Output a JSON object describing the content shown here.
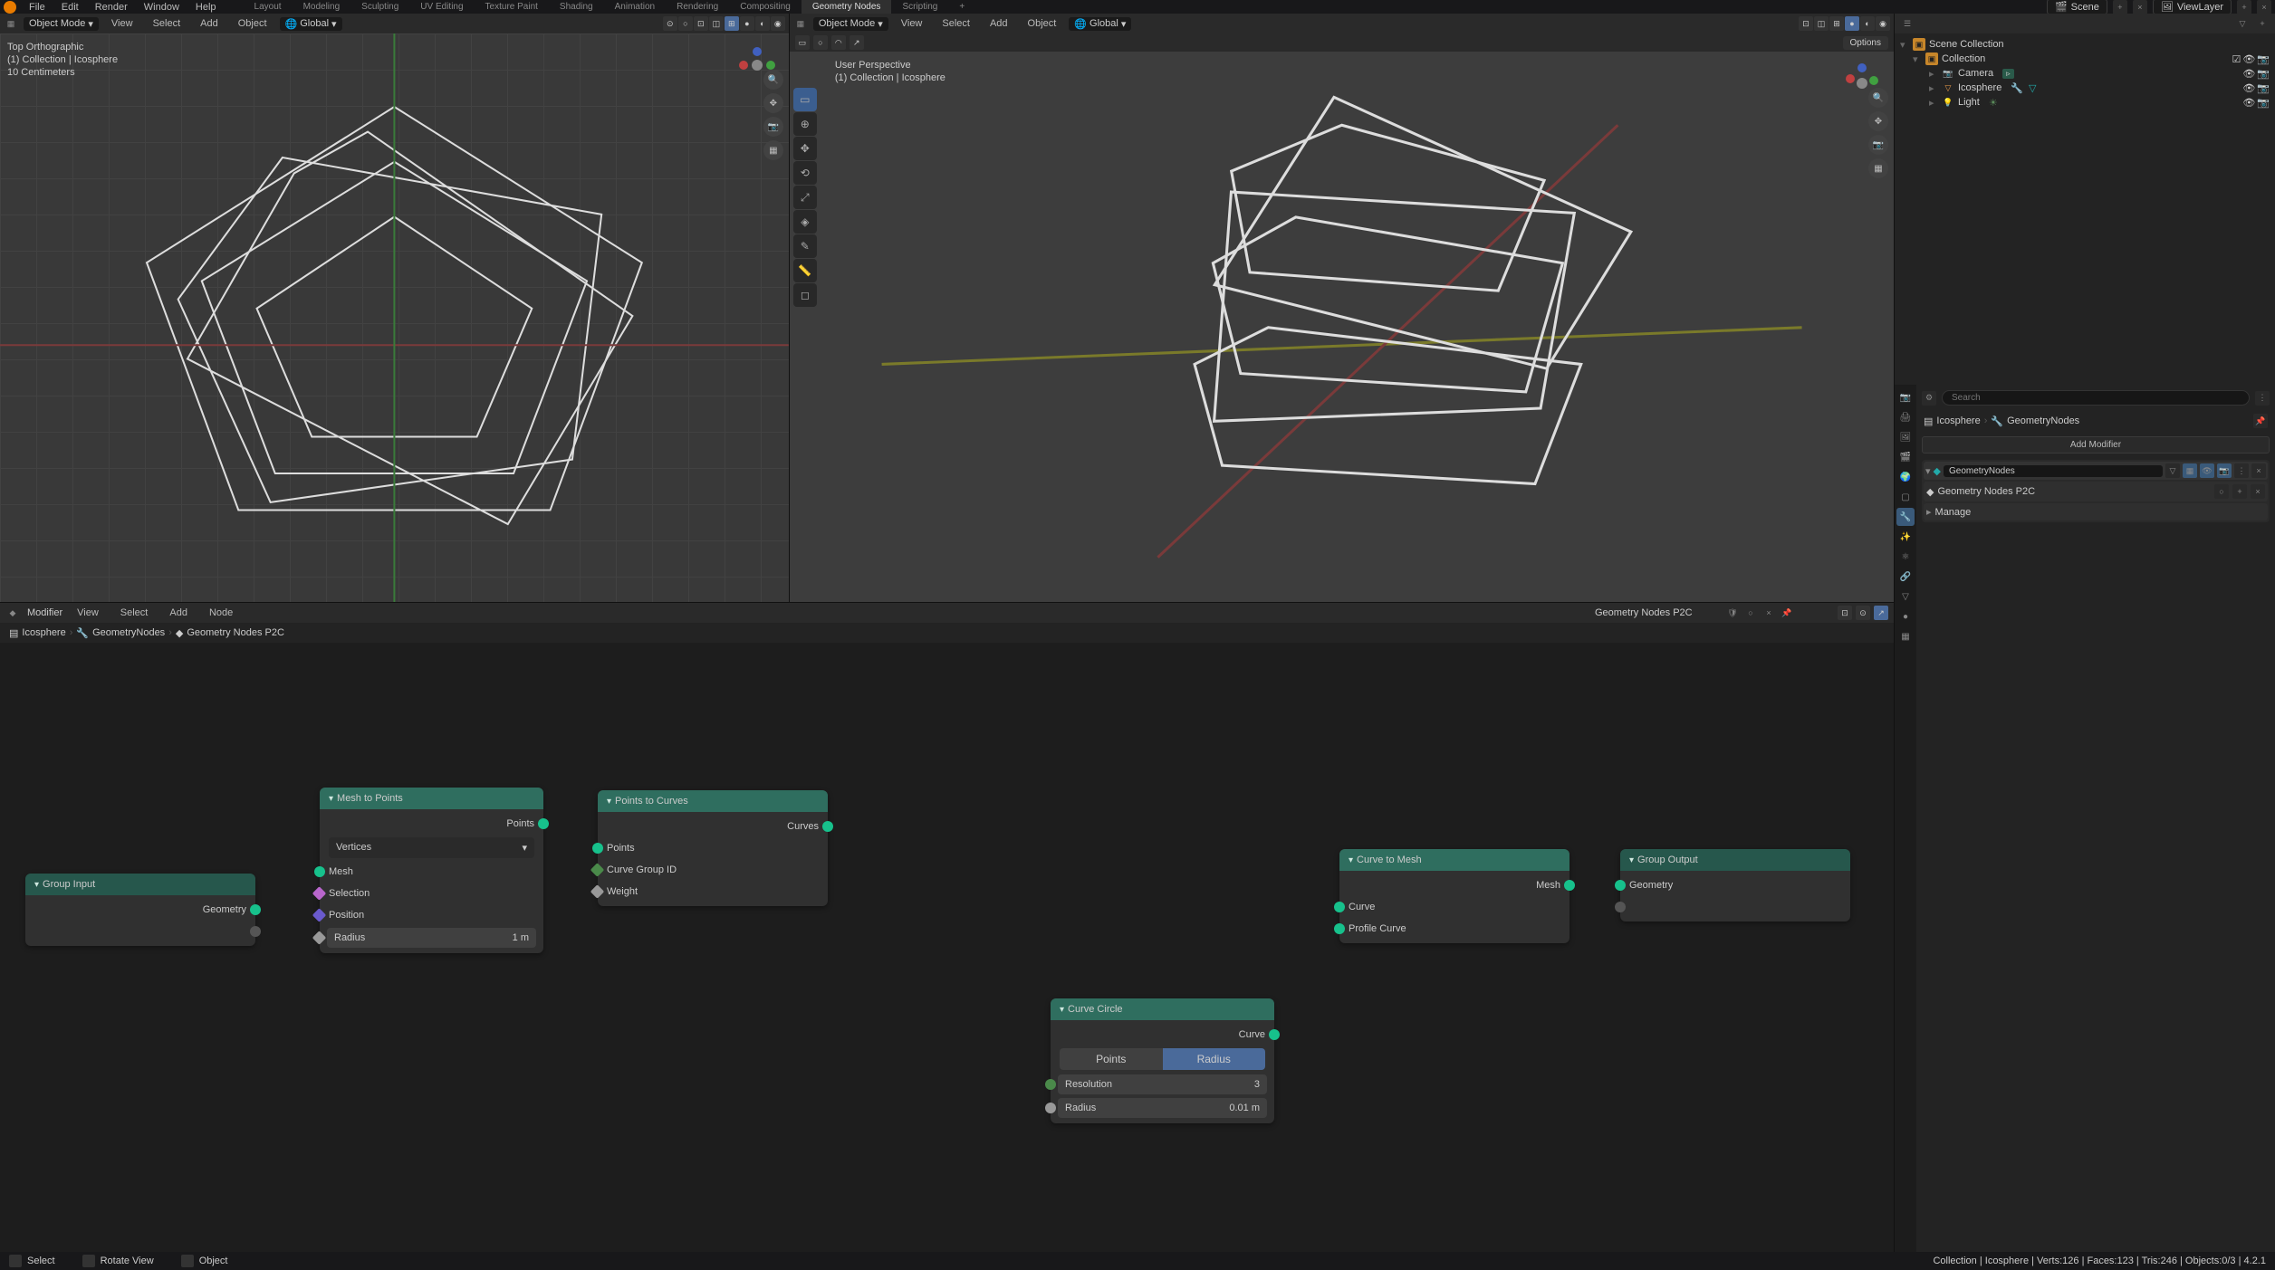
{
  "topmenu": {
    "file": "File",
    "edit": "Edit",
    "render": "Render",
    "window": "Window",
    "help": "Help"
  },
  "workspaces": {
    "layout": "Layout",
    "modeling": "Modeling",
    "sculpting": "Sculpting",
    "uv": "UV Editing",
    "texture": "Texture Paint",
    "shading": "Shading",
    "animation": "Animation",
    "rendering": "Rendering",
    "compositing": "Compositing",
    "geonodes": "Geometry Nodes",
    "scripting": "Scripting",
    "plus": "+"
  },
  "top_right": {
    "scene": "Scene",
    "viewlayer": "ViewLayer"
  },
  "vp": {
    "mode": "Object Mode",
    "view": "View",
    "select": "Select",
    "add": "Add",
    "object": "Object",
    "orient": "Global",
    "options": "Options"
  },
  "vp1_overlay": {
    "l1": "Top Orthographic",
    "l2": "(1) Collection | Icosphere",
    "l3": "10 Centimeters"
  },
  "vp2_overlay": {
    "l1": "User Perspective",
    "l2": "(1) Collection | Icosphere"
  },
  "outliner": {
    "scene_coll": "Scene Collection",
    "collection": "Collection",
    "camera": "Camera",
    "icosphere": "Icosphere",
    "light": "Light"
  },
  "props": {
    "search_ph": "Search",
    "bc_obj": "Icosphere",
    "bc_mod": "GeometryNodes",
    "add_modifier": "Add Modifier",
    "mod_name": "GeometryNodes",
    "ng_name": "Geometry Nodes P2C",
    "manage": "Manage"
  },
  "node_header": {
    "modifier": "Modifier",
    "view": "View",
    "select": "Select",
    "add": "Add",
    "node": "Node",
    "ng_name": "Geometry Nodes P2C"
  },
  "node_bc": {
    "a": "Icosphere",
    "b": "GeometryNodes",
    "c": "Geometry Nodes P2C"
  },
  "nodes": {
    "group_input": {
      "title": "Group Input",
      "geometry": "Geometry"
    },
    "mesh_to_points": {
      "title": "Mesh to Points",
      "points": "Points",
      "mode": "Vertices",
      "mesh": "Mesh",
      "selection": "Selection",
      "position": "Position",
      "radius_label": "Radius",
      "radius_val": "1 m"
    },
    "points_to_curves": {
      "title": "Points to Curves",
      "curves": "Curves",
      "points": "Points",
      "group_id": "Curve Group ID",
      "weight": "Weight"
    },
    "curve_circle": {
      "title": "Curve Circle",
      "curve": "Curve",
      "mode_points": "Points",
      "mode_radius": "Radius",
      "res_label": "Resolution",
      "res_val": "3",
      "rad_label": "Radius",
      "rad_val": "0.01 m"
    },
    "curve_to_mesh": {
      "title": "Curve to Mesh",
      "mesh": "Mesh",
      "curve": "Curve",
      "profile": "Profile Curve"
    },
    "group_output": {
      "title": "Group Output",
      "geometry": "Geometry"
    }
  },
  "status": {
    "select": "Select",
    "rotate": "Rotate View",
    "object": "Object",
    "right": "Collection | Icosphere | Verts:126 | Faces:123 | Tris:246 | Objects:0/3 | 4.2.1"
  }
}
